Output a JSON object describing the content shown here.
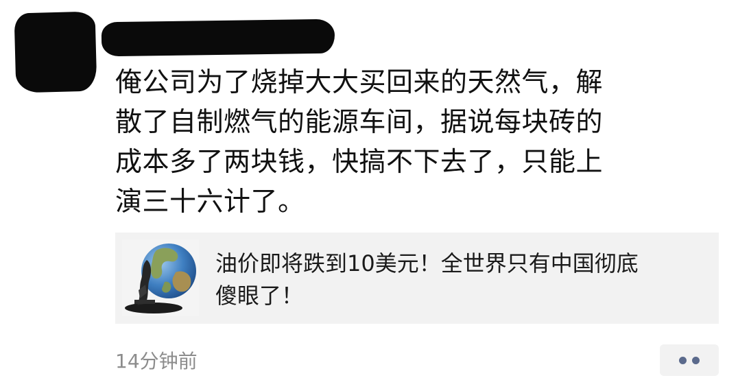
{
  "post": {
    "text": "俺公司为了烧掉大大买回来的天然气，解\n散了自制燃气的能源车间，据说每块砖的\n成本多了两块钱，快搞不下去了，只能上\n演三十六计了。"
  },
  "link_card": {
    "title": "油价即将跌到10美元！全世界只有中国彻底\n傻眼了！",
    "thumbnail_icon": "globe-oil-pump-icon"
  },
  "footer": {
    "timestamp": "14分钟前",
    "more_icon": "more-dots-icon"
  },
  "colors": {
    "text": "#111111",
    "card_bg": "#f2f2f2",
    "timestamp": "#8c8c8c",
    "dots": "#5b6a8c"
  }
}
